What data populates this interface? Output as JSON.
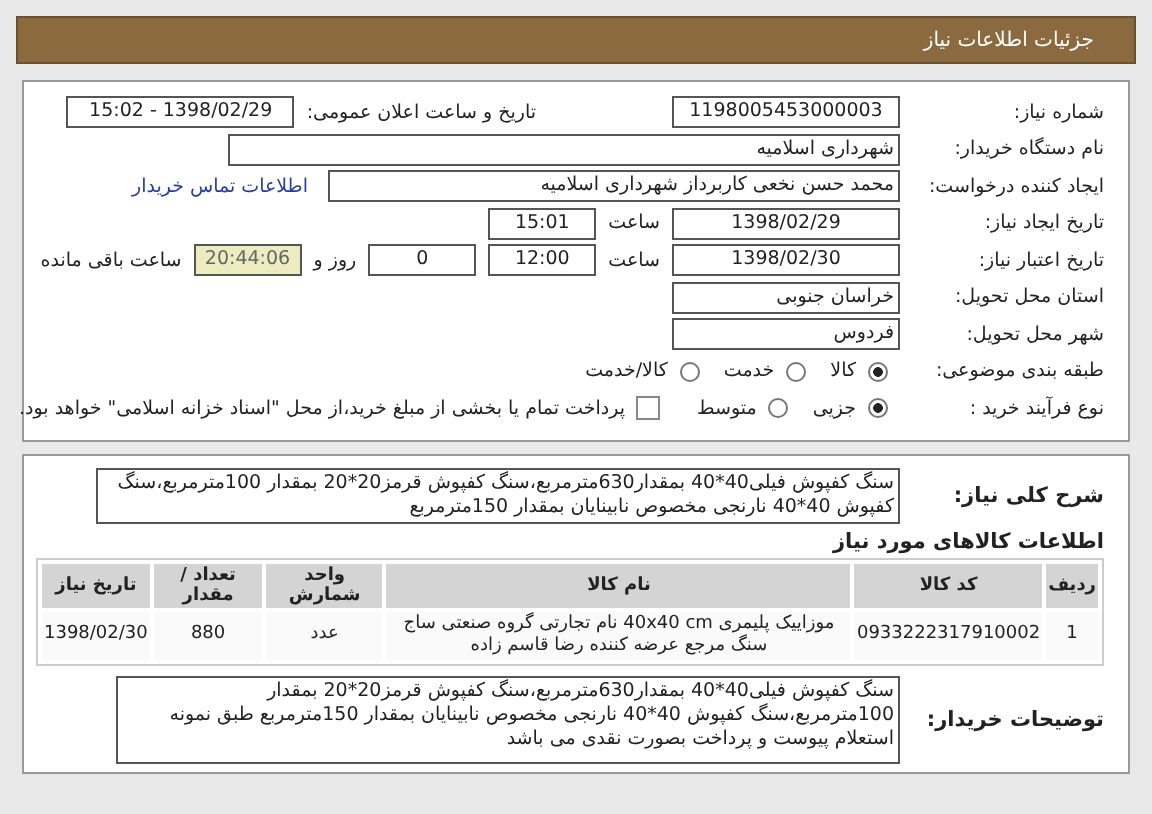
{
  "header": {
    "title": "جزئیات اطلاعات نیاز"
  },
  "info": {
    "need_number": {
      "label": "شماره نیاز:",
      "value": "1198005453000003"
    },
    "announce": {
      "label": "تاریخ و ساعت اعلان عمومی:",
      "value": "1398/02/29 - 15:02"
    },
    "buyer": {
      "label": "نام دستگاه خریدار:",
      "value": "شهرداری اسلامیه"
    },
    "creator": {
      "label": "ایجاد کننده درخواست:",
      "value": "محمد حسن نخعی کاربرداز شهرداری اسلامیه",
      "link": "اطلاعات تماس خریدار"
    },
    "created": {
      "label": "تاریخ ایجاد نیاز:",
      "date": "1398/02/29",
      "time_label": "ساعت",
      "time": "15:01"
    },
    "validity": {
      "label": "تاریخ اعتبار نیاز:",
      "date": "1398/02/30",
      "time_label": "ساعت",
      "time": "12:00",
      "days": "0",
      "days_label": "روز و",
      "remaining": "20:44:06",
      "remaining_label": "ساعت باقی مانده"
    },
    "province": {
      "label": "استان محل تحویل:",
      "value": "خراسان جنوبی"
    },
    "city": {
      "label": "شهر محل تحویل:",
      "value": "فردوس"
    },
    "category": {
      "label": "طبقه بندی موضوعی:",
      "options": [
        {
          "label": "کالا",
          "selected": true
        },
        {
          "label": "خدمت",
          "selected": false
        },
        {
          "label": "کالا/خدمت",
          "selected": false
        }
      ]
    },
    "process": {
      "label": "نوع فرآیند خرید :",
      "options": [
        {
          "label": "جزیی",
          "selected": true
        },
        {
          "label": "متوسط",
          "selected": false
        }
      ],
      "payment": {
        "label": "پرداخت تمام یا بخشی از مبلغ خرید،از محل \"اسناد خزانه اسلامی\" خواهد بود.",
        "checked": false
      }
    }
  },
  "summary": {
    "label": "شرح کلی نیاز:",
    "value": "سنگ کفپوش فیلی40*40 بمقدار630مترمربع،سنگ کفپوش قرمز20*20 بمقدار 100مترمربع،سنگ کفپوش 40*40 نارنجی مخصوص نابینایان بمقدار 150مترمربع"
  },
  "goods": {
    "title": "اطلاعات کالاهای مورد نیاز",
    "columns": [
      "ردیف",
      "کد کالا",
      "نام کالا",
      "واحد شمارش",
      "تعداد / مقدار",
      "تاریخ نیاز"
    ],
    "rows": [
      [
        "1",
        "0933222317910002",
        "موزاییک پلیمری 40x40 cm نام تجارتی گروه صنعتی ساج سنگ مرجع عرضه کننده رضا قاسم زاده",
        "عدد",
        "880",
        "1398/02/30"
      ]
    ]
  },
  "notes": {
    "label": "توضیحات خریدار:",
    "value": "سنگ کفپوش فیلی40*40 بمقدار630مترمربع،سنگ کفپوش قرمز20*20 بمقدار 100مترمربع،سنگ کفپوش 40*40 نارنجی مخصوص نابینایان بمقدار 150مترمربع طبق نمونه استعلام پیوست و پرداخت بصورت نقدی می باشد"
  }
}
